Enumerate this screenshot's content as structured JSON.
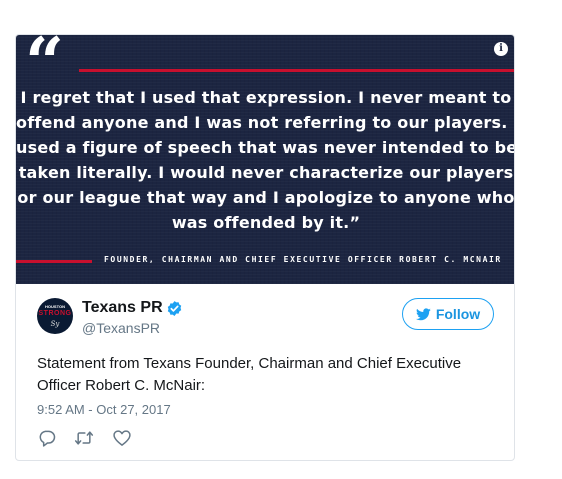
{
  "quote_card": {
    "quote_mark": "“",
    "info_icon": "i",
    "lines": [
      "I regret that I used that expression. I never meant to",
      "offend anyone and I was not referring to our players. I",
      "used a figure of speech that was never intended to be",
      "taken literally. I would never characterize our players",
      "or our league that way and I apologize to anyone who",
      "was offended by it.”"
    ],
    "attribution": "FOUNDER, CHAIRMAN AND CHIEF EXECUTIVE OFFICER ROBERT C. MCNAIR",
    "colors": {
      "background": "#1c2541",
      "accent": "#c8102e",
      "text": "#ffffff"
    }
  },
  "author": {
    "display_name": "Texans PR",
    "handle": "@TexansPR",
    "avatar_lines": [
      "HOUSTON",
      "STRONG",
      "Sy"
    ],
    "verified_icon": "verified-badge-icon",
    "verified_color": "#1da1f2"
  },
  "follow_button": {
    "label": "Follow",
    "icon": "twitter-bird-icon",
    "color": "#1da1f2"
  },
  "tweet": {
    "text": "Statement from Texans Founder, Chairman and Chief Executive Officer Robert C. McNair:",
    "timestamp": "9:52 AM - Oct 27, 2017"
  },
  "actions": [
    {
      "name": "reply",
      "icon": "reply-icon"
    },
    {
      "name": "retweet",
      "icon": "retweet-icon"
    },
    {
      "name": "like",
      "icon": "heart-icon"
    }
  ]
}
